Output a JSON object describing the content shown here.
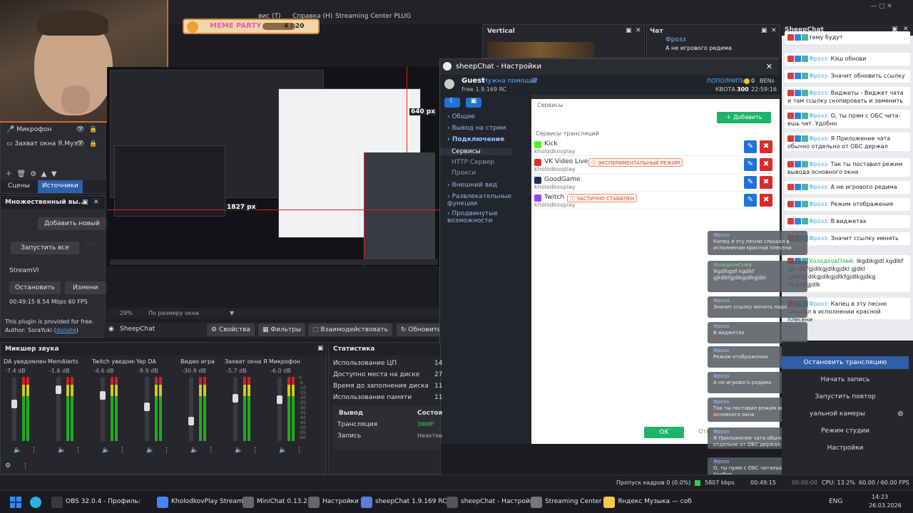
{
  "obs": {
    "menu": {
      "view_fragment": "вис (T)",
      "help": "Справка (H)",
      "plugin": "Streaming Center PLUG"
    },
    "meme": {
      "label": "MEME PARTY",
      "counter": "4 / 20"
    },
    "preview": {
      "zoom": "29%",
      "fit": "По размеру окна",
      "coord1": "640 px",
      "coord2": "1827 px"
    },
    "sources": [
      {
        "name": "Микрофон"
      },
      {
        "name": "Захват окна Я.Муз"
      }
    ],
    "tabs": {
      "scenes": "Сцены",
      "sources": "Источники"
    },
    "multi": {
      "title": "Множественный вы...",
      "add": "Добавить новый",
      "start_all": "Запустить все",
      "target": "StreamVI",
      "stop": "Остановить",
      "change": "Измени",
      "status": "00:49:15  8.54 Mbps  60 FPS",
      "note1": "This plugin is provided for free.",
      "note2_prefix": "Author: SoraYuki (",
      "note2_link": "donate",
      "note2_suffix": ")"
    },
    "source_bar": {
      "name": "SheepChat",
      "properties": "Свойства",
      "filters": "Фильтры",
      "interact": "Взаимодействовать",
      "refresh": "Обновить"
    },
    "docks": {
      "vertical": "Vertical",
      "chat": "Чат",
      "sheepchat": "SheepChat"
    },
    "twitch_chat": {
      "user": "Фрозз",
      "text": "А не игрового редима"
    },
    "mixer": {
      "title": "Микшер звука",
      "channels": [
        {
          "name": "DA уведомления",
          "db": "-7.4 dB",
          "level": 0.6
        },
        {
          "name": "MemAlerts",
          "db": "-1.6 dB",
          "level": 0.85
        },
        {
          "name": "Twitch уведомлен",
          "db": "-4.6 dB",
          "level": 0.75
        },
        {
          "name": "Yap DA",
          "db": "-9.9 dB",
          "level": 0.55
        },
        {
          "name": "Видео игра",
          "db": "-30.9 dB",
          "level": 0.3
        },
        {
          "name": "Захват окна Я.Муз",
          "db": "-5.7 dB",
          "level": 0.7
        },
        {
          "name": "Микрофон",
          "db": "-6.0 dB",
          "level": 0.68
        }
      ],
      "scale": [
        "0",
        "-5",
        "-10",
        "-15",
        "-20",
        "-25",
        "-30",
        "-35",
        "-40",
        "-45",
        "-50",
        "-55",
        "-60"
      ]
    },
    "stats": {
      "title": "Статистика",
      "rows": [
        {
          "label": "Использование ЦП",
          "value": "14"
        },
        {
          "label": "Доступно места на диске",
          "value": "27"
        },
        {
          "label": "Время до заполнения диска",
          "value": "11"
        },
        {
          "label": "Использование памяти",
          "value": "11"
        }
      ],
      "out_header": "Вывод",
      "status_header": "Состоя",
      "out_rows": [
        {
          "label": "Трансляция",
          "value": "ЭФИР"
        },
        {
          "label": "Запись",
          "value": "Неактив"
        }
      ]
    },
    "controls": {
      "stop_stream": "Остановить трансляцию",
      "start_record": "Начать запись",
      "replay": "Запустить повтор",
      "virtual_cam": "уальной камеры",
      "studio": "Режим студии",
      "settings": "Настройки"
    },
    "statusbar": {
      "dropped": "Пропуск кадров 0 (0.0%)",
      "bitrate": "5807 kbps",
      "time1": "00:49:15",
      "time2": "00:00:00",
      "cpu": "CPU: 13.2%",
      "fps": "60.00 / 60.00 FPS"
    }
  },
  "dialog": {
    "title": "sheepChat - Настройки",
    "user": "Guest",
    "help": "Нужна помощь?",
    "version": "Free 1.9.169 RC",
    "topup": "ПОПОЛНИТЬ",
    "bens": "0",
    "bens_unit": "BENs",
    "quota_label": "КВОТА",
    "quota": "300",
    "quota_time": "22:59:16",
    "sidebar": [
      {
        "label": "Общие",
        "active": false,
        "sub": false
      },
      {
        "label": "Вывод на стрим",
        "active": false,
        "sub": false
      },
      {
        "label": "Подключение",
        "active": true,
        "sub": false
      },
      {
        "label": "Сервисы",
        "active": true,
        "sub": true
      },
      {
        "label": "HTTP Сервер",
        "active": false,
        "sub": true
      },
      {
        "label": "Прокси",
        "active": false,
        "sub": true
      },
      {
        "label": "Внешний вид",
        "active": false,
        "sub": false
      },
      {
        "label": "Развлекательные функции",
        "active": false,
        "sub": false
      },
      {
        "label": "Продвинутые возможности",
        "active": false,
        "sub": false
      }
    ],
    "services_header": "Сервисы",
    "add": "Добавить",
    "streams_header": "Сервисы трансляций",
    "services": [
      {
        "name": "Kick",
        "user": "kholodkovplay",
        "badge": "",
        "color": "#53fc18"
      },
      {
        "name": "VK Video Live",
        "user": "kholodkovplay",
        "badge": "ЭКСПЕРИМЕНТАЛЬНЫЙ РЕЖИМ",
        "color": "#e0312f"
      },
      {
        "name": "GoodGame",
        "user": "kholodkovplay",
        "badge": "",
        "color": "#233056"
      },
      {
        "name": "Twitch",
        "user": "kholodkovplay",
        "badge": "ЧАСТИЧНО СТАБИЛЕН",
        "color": "#9146ff"
      }
    ],
    "ok": "OK",
    "cancel": "Отм"
  },
  "sheepchat": {
    "messages": [
      {
        "nick": "",
        "text": "тему будут"
      },
      {
        "nick": "Фрозз:",
        "text": "Кэш обнови"
      },
      {
        "nick": "Фрозз:",
        "text": "Значит обновить ссылку"
      },
      {
        "nick": "Фрозз:",
        "text": "Виджеты - Виджет чата и там ссылку скопировать и заменить"
      },
      {
        "nick": "Фрозз:",
        "text": "О, ты прям с ОБС чита-ешь чат. Удобно"
      },
      {
        "nick": "Фрозз:",
        "text": "Я Приложение чата обычно отдельно от ОБС держал"
      },
      {
        "nick": "Фрозз:",
        "text": "Так ты поставил режим вывода основного окна"
      },
      {
        "nick": "Фрозз:",
        "text": "А не игрового редима"
      },
      {
        "nick": "Фрозз:",
        "text": "Режим отображения"
      },
      {
        "nick": "Фрозз:",
        "text": "В виджетах"
      },
      {
        "nick": "Фрозз:",
        "text": "Значит ссылку менять"
      },
      {
        "nick": "ХолодковПлей:",
        "text": "lkgdlkgjdl kgdlkf gjk dlkfgjdlkgjdlkgjdkl gjdkl jglkdgjldlkgjdlkgjdlkfgjdlkgjdkg dkgjdkgjdlk"
      },
      {
        "nick": "Фрозз:",
        "text": "Капец в эту песню слышал в исполнении красной плесени"
      }
    ],
    "overlay": [
      {
        "nick": "Фрозз",
        "text": "Капец я эту песню слышал в исполнении красной плесени"
      },
      {
        "nick": "ХолодковПлей",
        "text": "lkgdlkgjdl kgdlkf gjkdlkfgjdlkgjdlkgjdkl"
      },
      {
        "nick": "Фрозз",
        "text": "Значит ссылку менять надо"
      },
      {
        "nick": "Фрозз",
        "text": "В виджетах"
      },
      {
        "nick": "Фрозз",
        "text": "Режим отображения"
      },
      {
        "nick": "Фрозз",
        "text": "А не игрового редима"
      },
      {
        "nick": "Фрозз",
        "text": "Так ты поставил режим вывода основного окна"
      },
      {
        "nick": "Фрозз",
        "text": "Я Приложение чата обычно отдельно от ОБС держал"
      },
      {
        "nick": "Фрозз",
        "text": "О, ты прям с ОБС читаешь чат. Удобно"
      }
    ]
  },
  "taskbar": {
    "items": [
      {
        "label": "OBS 32.0.4 - Профиль:",
        "color": "#3a3a3a"
      },
      {
        "label": "KholodkovPlay Stream -",
        "color": "#4285f4"
      },
      {
        "label": "MiniChat 0.13.2",
        "color": "#666"
      },
      {
        "label": "Настройки",
        "color": "#666"
      },
      {
        "label": "sheepChat 1.9.169 RC [Fr",
        "color": "#5a7dd8"
      },
      {
        "label": "sheepChat - Настройки",
        "color": "#555"
      },
      {
        "label": "Streaming Center",
        "color": "#777"
      },
      {
        "label": "Яндекс Музыка — соб",
        "color": "#f7c948"
      }
    ],
    "lang": "ENG",
    "time": "14:23",
    "date": "26.03.2026"
  }
}
